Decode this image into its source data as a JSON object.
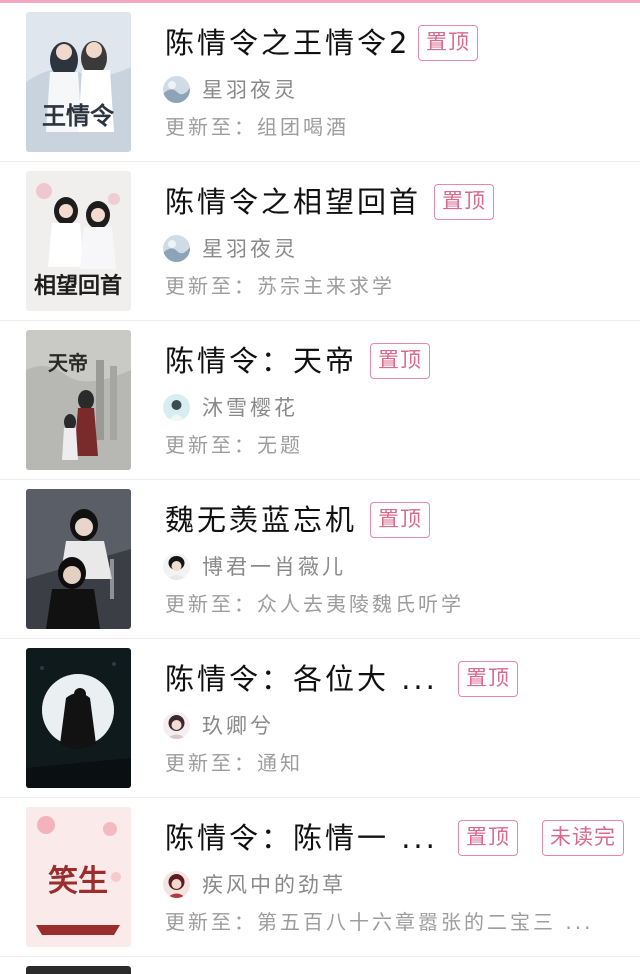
{
  "labels": {
    "pin": "置顶",
    "unread_done": "未读完",
    "update_prefix": "更新至："
  },
  "books": [
    {
      "title": "陈情令之王情令2",
      "author": "星羽夜灵",
      "latest_chapter": "组团喝酒",
      "cover_text": "王情令",
      "colors": {
        "bg": "#dfe6ee",
        "accent": "#2c3440"
      }
    },
    {
      "title": "陈情令之相望回首",
      "author": "星羽夜灵",
      "latest_chapter": "苏宗主来求学",
      "cover_text": "相望回首",
      "colors": {
        "bg": "#f1eeee",
        "accent": "#1d1d1d"
      }
    },
    {
      "title": "陈情令：天帝",
      "author": "沐雪樱花",
      "latest_chapter": "无题",
      "cover_text": "天帝",
      "colors": {
        "bg": "#c9c9c6",
        "accent": "#2a2a2a"
      }
    },
    {
      "title": "魏无羡蓝忘机",
      "author": "博君一肖薇儿",
      "latest_chapter": "众人去夷陵魏氏听学",
      "cover_text": "",
      "colors": {
        "bg": "#3b3e45",
        "accent": "#e9e9e9"
      }
    },
    {
      "title": "陈情令：各位大 ...",
      "author": "玖卿兮",
      "latest_chapter": "通知",
      "cover_text": "",
      "colors": {
        "bg": "#0f1a1d",
        "accent": "#dfe7e8"
      }
    },
    {
      "title": "陈情令：陈情一 ...",
      "author": "疾风中的劲草",
      "latest_chapter": "第五百八十六章嚣张的二宝三 ...",
      "cover_text": "笑生",
      "colors": {
        "bg": "#fbeaea",
        "accent": "#9c2d2d"
      }
    }
  ]
}
